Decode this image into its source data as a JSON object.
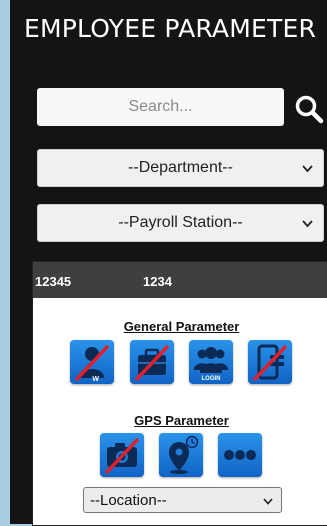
{
  "header": {
    "title": "EMPLOYEE PARAMETER"
  },
  "search": {
    "placeholder": "Search..."
  },
  "filters": {
    "department": "--Department--",
    "payroll_station": "--Payroll Station--"
  },
  "employee": {
    "code_a": "12345",
    "code_b": "1234"
  },
  "general_parameter": {
    "title": "General Parameter",
    "icons": [
      "user-disabled-icon",
      "briefcase-disabled-icon",
      "group-login-icon",
      "phone-disabled-icon"
    ],
    "user_tile_mark": "W",
    "login_tile_label": "LOGIN"
  },
  "gps_parameter": {
    "title": "GPS Parameter",
    "icons": [
      "camera-disabled-icon",
      "map-pin-clock-icon",
      "more-dots-icon"
    ],
    "location_select": "--Location--"
  },
  "colors": {
    "background": "#141414",
    "tile": "#1a73d6",
    "strike": "#e0202a"
  }
}
